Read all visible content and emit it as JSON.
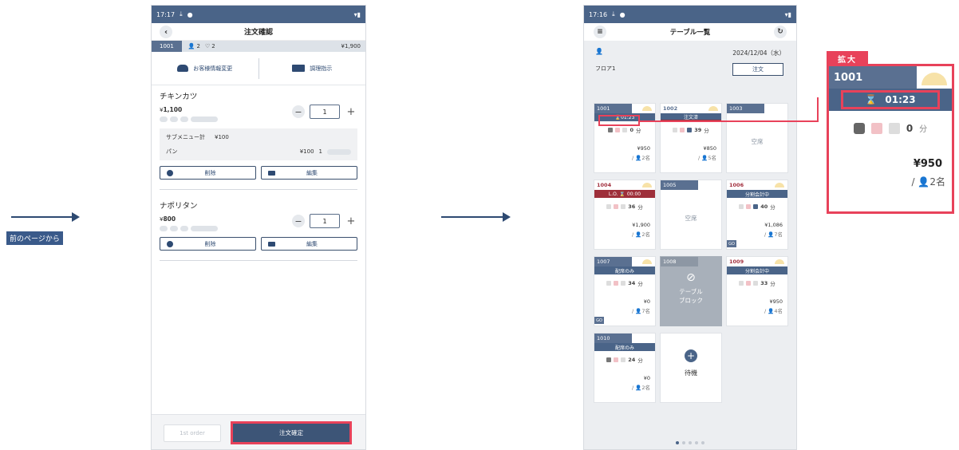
{
  "left_note": {
    "label": "前のページから"
  },
  "order_screen": {
    "status_time": "17:17",
    "title": "注文確認",
    "table_no": "1001",
    "guests": "2",
    "seats": "2",
    "total": "¥1,900",
    "action_customer": "お客様情報変更",
    "action_kitchen": "調理指示",
    "items": [
      {
        "name": "チキンカツ",
        "price": "1,100",
        "qty": "1"
      },
      {
        "name": "ナポリタン",
        "price": "800",
        "qty": "1"
      }
    ],
    "submenu_title": "サブメニュー計",
    "submenu_total": "¥100",
    "submenu_item": "パン",
    "submenu_item_price": "¥100",
    "submenu_item_qty": "1",
    "delete_label": "削除",
    "edit_label": "編集",
    "first_order_label": "1st order",
    "confirm_label": "注文確定"
  },
  "table_screen": {
    "status_time": "17:16",
    "title": "テーブル一覧",
    "date": "2024/12/04（水）",
    "floor": "フロア1",
    "order_button": "注文",
    "tables": [
      {
        "no": "1001",
        "band": "01:23",
        "mins": "0",
        "amount": "¥950",
        "people": "2名"
      },
      {
        "no": "1002",
        "band": "注文済",
        "mins": "39",
        "amount": "¥850",
        "people": "5名"
      },
      {
        "no": "1003",
        "empty": "空席"
      },
      {
        "no": "1004",
        "band": "L.O. ⌛ 00:00",
        "mins": "36",
        "amount": "¥1,900",
        "people": "2名"
      },
      {
        "no": "1005",
        "empty": "空席"
      },
      {
        "no": "1006",
        "band": "分割会計中",
        "mins": "40",
        "amount": "¥1,086",
        "people": "7名"
      },
      {
        "no": "1007",
        "band": "配席のみ",
        "mins": "34",
        "amount": "¥0",
        "people": "7名"
      },
      {
        "no": "1008",
        "block": "テーブル\nブロック"
      },
      {
        "no": "1009",
        "band": "分割会計中",
        "mins": "33",
        "amount": "¥950",
        "people": "4名"
      },
      {
        "no": "1010",
        "band": "配席のみ",
        "mins": "24",
        "amount": "¥0",
        "people": "2名"
      }
    ],
    "waiting_label": "待機",
    "minute_unit": "分"
  },
  "zoom": {
    "label": "拡大",
    "table_no": "1001",
    "timer": "01:23",
    "mins": "0",
    "unit": "分",
    "amount": "¥950",
    "people_prefix": "/",
    "people": "2名"
  },
  "colors": {
    "accent": "#e8425a",
    "header": "#4a6488",
    "table_no_bg": "#5a7091"
  }
}
